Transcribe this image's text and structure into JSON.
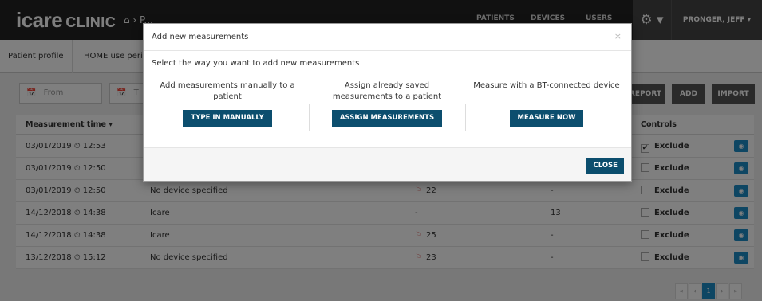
{
  "brand": {
    "icare": "icare",
    "clinic": "CLINIC"
  },
  "breadcrumb": {
    "home_prefix": "⌂ › P..."
  },
  "nav": {
    "tabs": [
      "PATIENTS",
      "DEVICES",
      "USERS"
    ],
    "gear": "⚙ ▾",
    "user": "PRONGER, JEFF ▾"
  },
  "subnav": {
    "tabs": [
      "Patient profile",
      "HOME use perio..."
    ]
  },
  "filters": {
    "from_placeholder": "From",
    "to_placeholder": "T",
    "report_label": "REPORT",
    "add_label": "ADD",
    "import_label": "IMPORT"
  },
  "table": {
    "headers": {
      "time": "Measurement time",
      "controls": "Controls"
    },
    "exclude_label": "Exclude",
    "rows": [
      {
        "time": "03/01/2019 ⏲ 12:53",
        "device": "",
        "iop_right": "",
        "iop_left": "",
        "excluded": true
      },
      {
        "time": "03/01/2019 ⏲ 12:50",
        "device": "",
        "iop_right": "",
        "iop_left": "",
        "excluded": false
      },
      {
        "time": "03/01/2019 ⏲ 12:50",
        "device": "No device specified",
        "iop_right": "22",
        "iop_left": "-",
        "excluded": false
      },
      {
        "time": "14/12/2018 ⏲ 14:38",
        "device": "Icare",
        "iop_right": "-",
        "iop_left": "13",
        "excluded": false
      },
      {
        "time": "14/12/2018 ⏲ 14:38",
        "device": "Icare",
        "iop_right": "25",
        "iop_left": "-",
        "excluded": false
      },
      {
        "time": "13/12/2018 ⏲ 15:12",
        "device": "No device specified",
        "iop_right": "23",
        "iop_left": "-",
        "excluded": false
      }
    ]
  },
  "pager": {
    "first": "«",
    "prev": "‹",
    "current": "1",
    "next": "›",
    "last": "»"
  },
  "modal": {
    "title": "Add new measurements",
    "close_x": "×",
    "prompt": "Select the way you want to add new measurements",
    "options": [
      {
        "text": "Add measurements manually to a patient",
        "button": "TYPE IN MANUALLY"
      },
      {
        "text": "Assign already saved measurements to a patient",
        "button": "ASSIGN MEASUREMENTS"
      },
      {
        "text": "Measure with a BT-connected device",
        "button": "MEASURE NOW"
      }
    ],
    "close_button": "CLOSE"
  }
}
